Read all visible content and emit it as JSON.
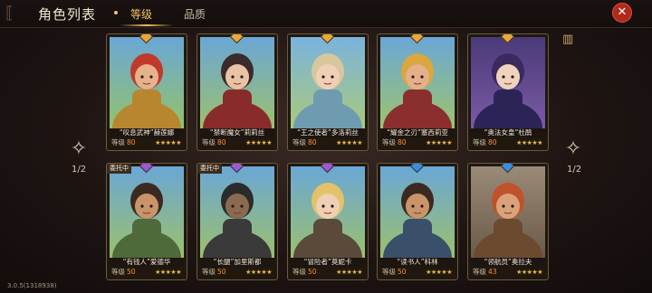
{
  "header": {
    "title": "角色列表",
    "tabs": [
      {
        "label": "等级",
        "active": true
      },
      {
        "label": "品质",
        "active": false
      }
    ],
    "close_icon": "close-icon",
    "filter_icon": "filter-icon"
  },
  "pagination": {
    "left": "1/2",
    "right": "1/2"
  },
  "version": "3.0.5(1318938)",
  "colors": {
    "accent": "#f2c36b",
    "level_value": "#ff8d2b",
    "close_button": "#b02a1c"
  },
  "cards": [
    {
      "name": "“叹息武神”赫莲娜",
      "level_label": "等级",
      "level": "80",
      "badge": "",
      "gem_color": "#e9a83a",
      "bg1": "#6aa7d6",
      "bg2": "#93c36a",
      "skin": "#e6b28c",
      "hair": "#c0392b",
      "outfit": "#b8862f"
    },
    {
      "name": "“禁断魔女”莉莉丝",
      "level_label": "等级",
      "level": "80",
      "badge": "",
      "gem_color": "#e9a83a",
      "bg1": "#6aa7d6",
      "bg2": "#9cc06d",
      "skin": "#eac3a4",
      "hair": "#3b2a2a",
      "outfit": "#8a2b2b"
    },
    {
      "name": "“王之使者”多洛莉丝",
      "level_label": "等级",
      "level": "80",
      "badge": "",
      "gem_color": "#e9a83a",
      "bg1": "#7ab3de",
      "bg2": "#a9c97b",
      "skin": "#efcfb5",
      "hair": "#d8c69c",
      "outfit": "#6f9bb0"
    },
    {
      "name": "“耀金之刃”塞西莉亚",
      "level_label": "等级",
      "level": "80",
      "badge": "",
      "gem_color": "#e9a83a",
      "bg1": "#6aa7d6",
      "bg2": "#9ec36e",
      "skin": "#e3b08b",
      "hair": "#d9a63f",
      "outfit": "#8b2e2e"
    },
    {
      "name": "“奥法女皇”杜鹃",
      "level_label": "等级",
      "level": "80",
      "badge": "",
      "gem_color": "#e9a83a",
      "bg1": "#4a3a78",
      "bg2": "#7a5aa6",
      "skin": "#f0d3bd",
      "hair": "#3a2a5e",
      "outfit": "#2c2456"
    },
    {
      "name": "“有钱人”爱德华",
      "level_label": "等级",
      "level": "50",
      "badge": "委托中",
      "gem_color": "#9b59d6",
      "bg1": "#6aa7d6",
      "bg2": "#9cc06d",
      "skin": "#c9946a",
      "hair": "#3b2a22",
      "outfit": "#4f6a3a"
    },
    {
      "name": "“长腿”加里斯都",
      "level_label": "等级",
      "level": "50",
      "badge": "委托中",
      "gem_color": "#9b59d6",
      "bg1": "#6aa7d6",
      "bg2": "#9cc06d",
      "skin": "#8a6a50",
      "hair": "#2b2b2b",
      "outfit": "#3a3a3a"
    },
    {
      "name": "“冒险者”莫妮卡",
      "level_label": "等级",
      "level": "50",
      "badge": "",
      "gem_color": "#9b59d6",
      "bg1": "#6aa7d6",
      "bg2": "#9cc06d",
      "skin": "#efcfb5",
      "hair": "#e3c26a",
      "outfit": "#5a4a3a"
    },
    {
      "name": "“读书人”科林",
      "level_label": "等级",
      "level": "50",
      "badge": "",
      "gem_color": "#3a8de0",
      "bg1": "#6aa7d6",
      "bg2": "#9cc06d",
      "skin": "#c9946a",
      "hair": "#3b2a22",
      "outfit": "#3a4f6a"
    },
    {
      "name": "“领航员”奥拉夫",
      "level_label": "等级",
      "level": "43",
      "badge": "",
      "gem_color": "#3a8de0",
      "bg1": "#9a8a78",
      "bg2": "#6b5a48",
      "skin": "#d9a27a",
      "hair": "#c0522b",
      "outfit": "#6b4a30"
    }
  ]
}
